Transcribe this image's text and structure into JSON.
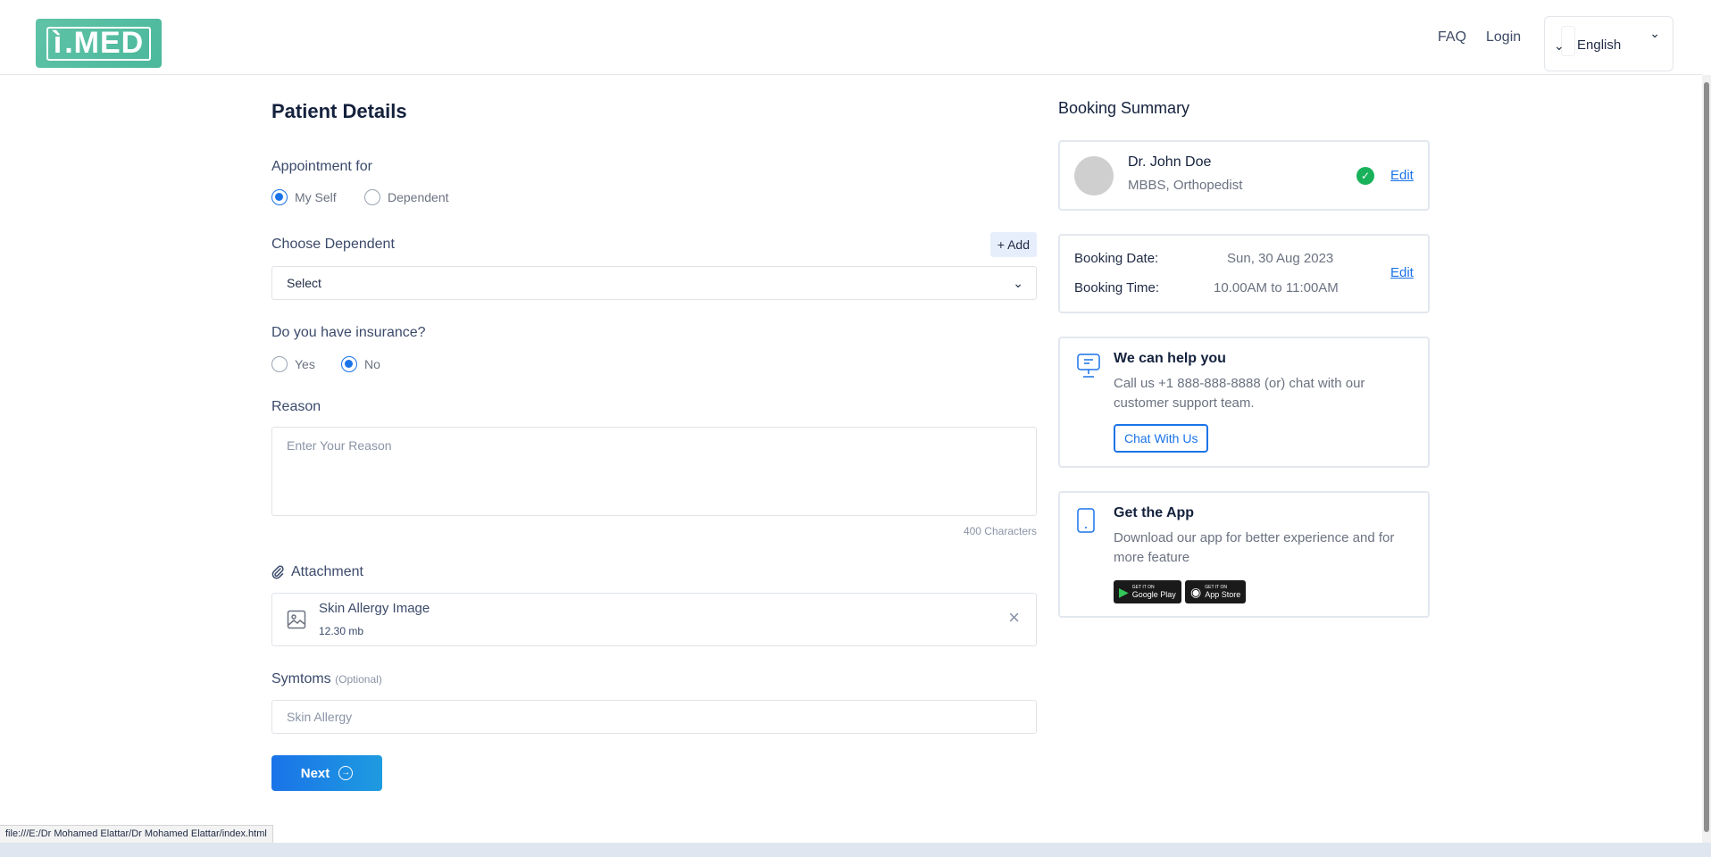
{
  "header": {
    "logo_text": ".MED",
    "nav": {
      "faq": "FAQ",
      "login": "Login"
    },
    "language": "English"
  },
  "patient": {
    "title": "Patient Details",
    "appointment_for": {
      "label": "Appointment for",
      "options": [
        {
          "label": "My Self",
          "selected": true
        },
        {
          "label": "Dependent",
          "selected": false
        }
      ]
    },
    "dependent": {
      "label": "Choose Dependent",
      "add_label": "+ Add",
      "select_value": "Select"
    },
    "insurance": {
      "label": "Do you have insurance?",
      "options": [
        {
          "label": "Yes",
          "selected": false
        },
        {
          "label": "No",
          "selected": true
        }
      ]
    },
    "reason": {
      "label": "Reason",
      "placeholder": "Enter Your Reason",
      "limit": "400 Characters"
    },
    "attachment": {
      "label": "Attachment",
      "file_name": "Skin Allergy Image",
      "file_size": "12.30 mb"
    },
    "symptoms": {
      "label": "Symtoms",
      "optional": "(Optional)",
      "placeholder": "Skin Allergy"
    },
    "next_label": "Next"
  },
  "summary": {
    "title": "Booking Summary",
    "doctor": {
      "name": "Dr. John Doe",
      "specialty": "MBBS, Orthopedist",
      "edit": "Edit"
    },
    "booking": {
      "date_label": "Booking Date:",
      "date_value": "Sun, 30 Aug 2023",
      "time_label": "Booking Time:",
      "time_value": "10.00AM to 11:00AM",
      "edit": "Edit"
    },
    "help": {
      "title": "We can help you",
      "text": "Call us +1 888-888-8888 (or) chat with our customer support team.",
      "button": "Chat With Us"
    },
    "app": {
      "title": "Get the App",
      "text": "Download our app for better experience and for more feature",
      "google_small": "GET IT ON",
      "google_big": "Google Play",
      "apple_small": "GET IT ON",
      "apple_big": "App Store"
    }
  },
  "statusbar": {
    "url": "file:///E:/Dr Mohamed Elattar/Dr Mohamed Elattar/index.html"
  },
  "colors": {
    "accent": "#1a73e8",
    "brand": "#5fc3a7",
    "success": "#19b25a"
  }
}
